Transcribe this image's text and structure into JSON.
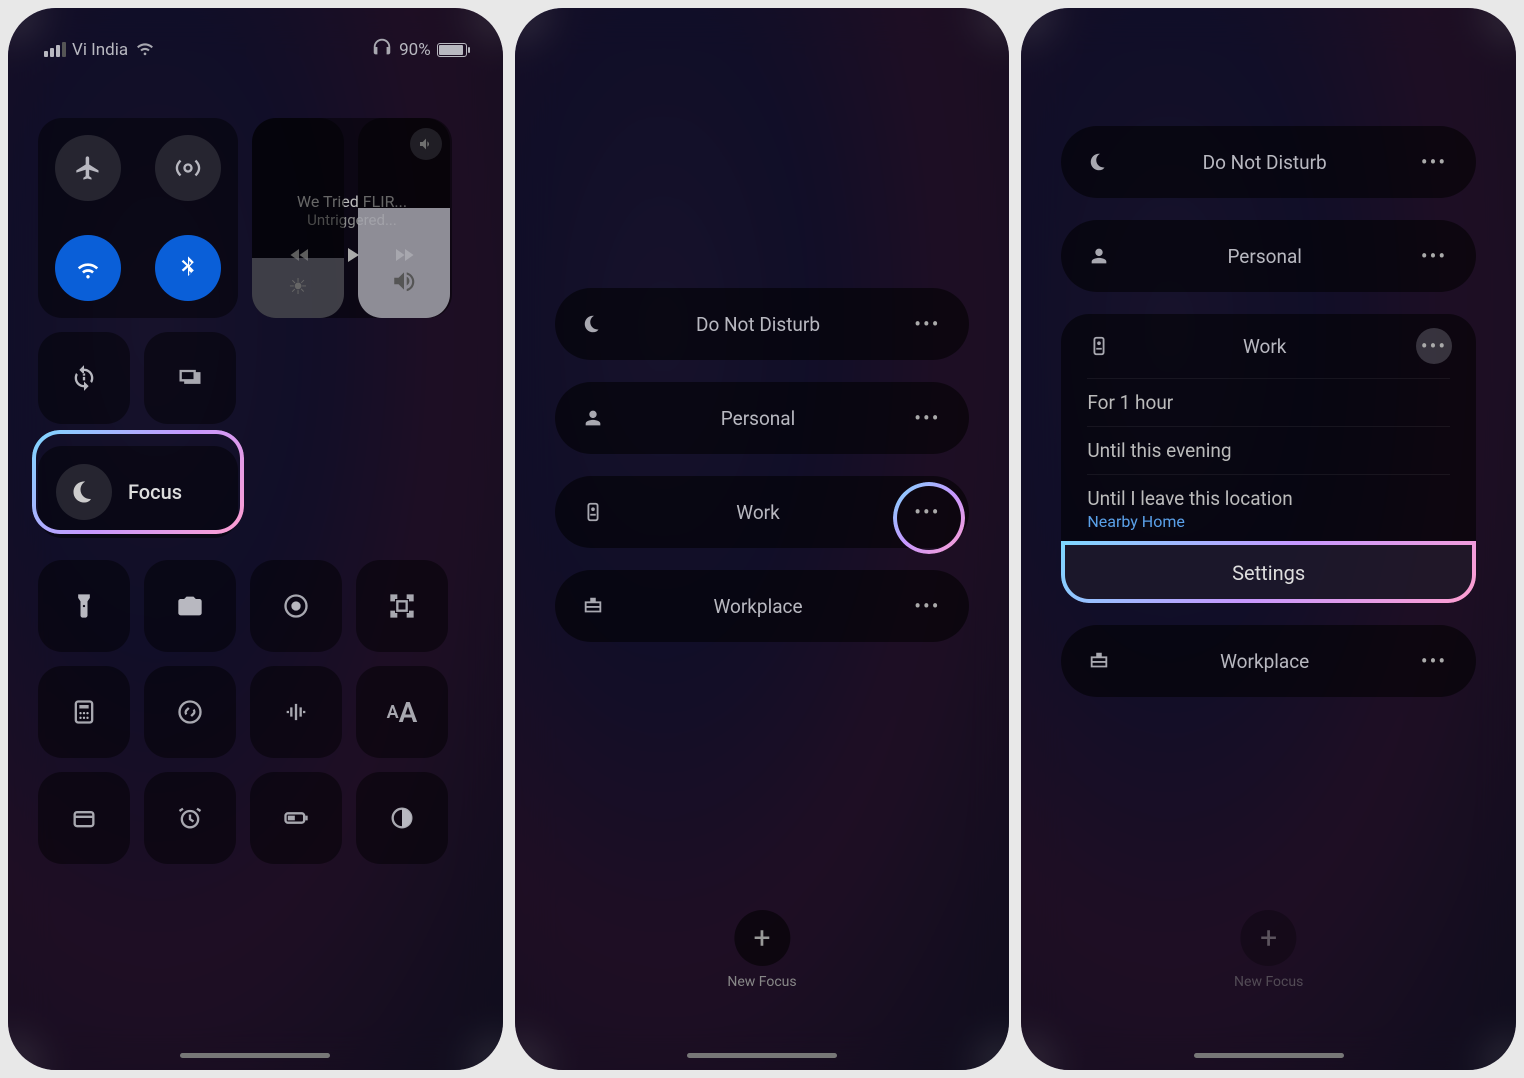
{
  "status": {
    "carrier": "Vi India",
    "battery_pct": "90%"
  },
  "media": {
    "title": "We Tried FLIR...",
    "subtitle": "Untriggered..."
  },
  "focus_button": {
    "label": "Focus"
  },
  "focus_modes": [
    {
      "key": "dnd",
      "label": "Do Not Disturb",
      "icon": "moon"
    },
    {
      "key": "personal",
      "label": "Personal",
      "icon": "person"
    },
    {
      "key": "work",
      "label": "Work",
      "icon": "badge"
    },
    {
      "key": "workplace",
      "label": "Workplace",
      "icon": "briefcase"
    }
  ],
  "work_options": {
    "hour": "For 1 hour",
    "evening": "Until this evening",
    "location": "Until I leave this location",
    "location_sub": "Nearby Home",
    "settings": "Settings"
  },
  "new_focus": {
    "label": "New Focus"
  }
}
